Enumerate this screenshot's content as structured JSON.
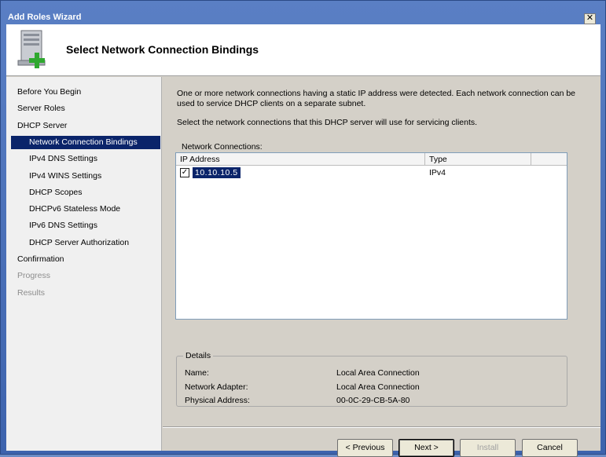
{
  "window": {
    "title": "Add Roles Wizard",
    "close_glyph": "✕"
  },
  "header": {
    "title": "Select Network Connection Bindings",
    "icon": "server-add-icon"
  },
  "nav": {
    "items": [
      {
        "label": "Before You Begin",
        "level": 0,
        "state": "normal"
      },
      {
        "label": "Server Roles",
        "level": 0,
        "state": "normal"
      },
      {
        "label": "DHCP Server",
        "level": 0,
        "state": "normal"
      },
      {
        "label": "Network Connection Bindings",
        "level": 1,
        "state": "active"
      },
      {
        "label": "IPv4 DNS Settings",
        "level": 1,
        "state": "normal"
      },
      {
        "label": "IPv4 WINS Settings",
        "level": 1,
        "state": "normal"
      },
      {
        "label": "DHCP Scopes",
        "level": 1,
        "state": "normal"
      },
      {
        "label": "DHCPv6 Stateless Mode",
        "level": 1,
        "state": "normal"
      },
      {
        "label": "IPv6 DNS Settings",
        "level": 1,
        "state": "normal"
      },
      {
        "label": "DHCP Server Authorization",
        "level": 1,
        "state": "normal"
      },
      {
        "label": "Confirmation",
        "level": 0,
        "state": "normal"
      },
      {
        "label": "Progress",
        "level": 0,
        "state": "disabled"
      },
      {
        "label": "Results",
        "level": 0,
        "state": "disabled"
      }
    ]
  },
  "content": {
    "description": "One or more network connections having a static IP address were detected. Each network connection can be used to service DHCP clients on a separate subnet.",
    "instruction": "Select the network connections that this DHCP server will use for servicing clients.",
    "list_label": "Network Connections:",
    "columns": {
      "ip": "IP Address",
      "type": "Type"
    },
    "rows": [
      {
        "checked": true,
        "ip": "10.10.10.5",
        "type": "IPv4"
      }
    ]
  },
  "details": {
    "legend": "Details",
    "name_label": "Name:",
    "name_value": "Local Area Connection",
    "adapter_label": "Network Adapter:",
    "adapter_value": "Local Area Connection",
    "mac_label": "Physical Address:",
    "mac_value": "00-0C-29-CB-5A-80"
  },
  "buttons": {
    "previous": "< Previous",
    "next": "Next >",
    "install": "Install",
    "cancel": "Cancel"
  }
}
